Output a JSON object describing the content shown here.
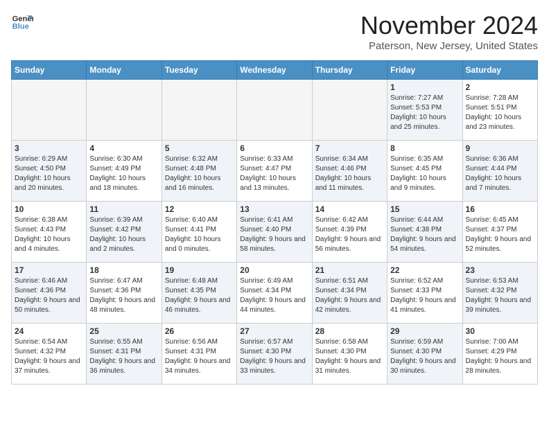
{
  "header": {
    "logo_general": "General",
    "logo_blue": "Blue",
    "month_title": "November 2024",
    "location": "Paterson, New Jersey, United States"
  },
  "days_of_week": [
    "Sunday",
    "Monday",
    "Tuesday",
    "Wednesday",
    "Thursday",
    "Friday",
    "Saturday"
  ],
  "weeks": [
    [
      {
        "day": "",
        "info": "",
        "empty": true
      },
      {
        "day": "",
        "info": "",
        "empty": true
      },
      {
        "day": "",
        "info": "",
        "empty": true
      },
      {
        "day": "",
        "info": "",
        "empty": true
      },
      {
        "day": "",
        "info": "",
        "empty": true
      },
      {
        "day": "1",
        "info": "Sunrise: 7:27 AM\nSunset: 5:53 PM\nDaylight: 10 hours and 25 minutes.",
        "shaded": true
      },
      {
        "day": "2",
        "info": "Sunrise: 7:28 AM\nSunset: 5:51 PM\nDaylight: 10 hours and 23 minutes.",
        "shaded": false
      }
    ],
    [
      {
        "day": "3",
        "info": "Sunrise: 6:29 AM\nSunset: 4:50 PM\nDaylight: 10 hours and 20 minutes.",
        "shaded": true
      },
      {
        "day": "4",
        "info": "Sunrise: 6:30 AM\nSunset: 4:49 PM\nDaylight: 10 hours and 18 minutes.",
        "shaded": false
      },
      {
        "day": "5",
        "info": "Sunrise: 6:32 AM\nSunset: 4:48 PM\nDaylight: 10 hours and 16 minutes.",
        "shaded": true
      },
      {
        "day": "6",
        "info": "Sunrise: 6:33 AM\nSunset: 4:47 PM\nDaylight: 10 hours and 13 minutes.",
        "shaded": false
      },
      {
        "day": "7",
        "info": "Sunrise: 6:34 AM\nSunset: 4:46 PM\nDaylight: 10 hours and 11 minutes.",
        "shaded": true
      },
      {
        "day": "8",
        "info": "Sunrise: 6:35 AM\nSunset: 4:45 PM\nDaylight: 10 hours and 9 minutes.",
        "shaded": false
      },
      {
        "day": "9",
        "info": "Sunrise: 6:36 AM\nSunset: 4:44 PM\nDaylight: 10 hours and 7 minutes.",
        "shaded": true
      }
    ],
    [
      {
        "day": "10",
        "info": "Sunrise: 6:38 AM\nSunset: 4:43 PM\nDaylight: 10 hours and 4 minutes.",
        "shaded": false
      },
      {
        "day": "11",
        "info": "Sunrise: 6:39 AM\nSunset: 4:42 PM\nDaylight: 10 hours and 2 minutes.",
        "shaded": true
      },
      {
        "day": "12",
        "info": "Sunrise: 6:40 AM\nSunset: 4:41 PM\nDaylight: 10 hours and 0 minutes.",
        "shaded": false
      },
      {
        "day": "13",
        "info": "Sunrise: 6:41 AM\nSunset: 4:40 PM\nDaylight: 9 hours and 58 minutes.",
        "shaded": true
      },
      {
        "day": "14",
        "info": "Sunrise: 6:42 AM\nSunset: 4:39 PM\nDaylight: 9 hours and 56 minutes.",
        "shaded": false
      },
      {
        "day": "15",
        "info": "Sunrise: 6:44 AM\nSunset: 4:38 PM\nDaylight: 9 hours and 54 minutes.",
        "shaded": true
      },
      {
        "day": "16",
        "info": "Sunrise: 6:45 AM\nSunset: 4:37 PM\nDaylight: 9 hours and 52 minutes.",
        "shaded": false
      }
    ],
    [
      {
        "day": "17",
        "info": "Sunrise: 6:46 AM\nSunset: 4:36 PM\nDaylight: 9 hours and 50 minutes.",
        "shaded": true
      },
      {
        "day": "18",
        "info": "Sunrise: 6:47 AM\nSunset: 4:36 PM\nDaylight: 9 hours and 48 minutes.",
        "shaded": false
      },
      {
        "day": "19",
        "info": "Sunrise: 6:48 AM\nSunset: 4:35 PM\nDaylight: 9 hours and 46 minutes.",
        "shaded": true
      },
      {
        "day": "20",
        "info": "Sunrise: 6:49 AM\nSunset: 4:34 PM\nDaylight: 9 hours and 44 minutes.",
        "shaded": false
      },
      {
        "day": "21",
        "info": "Sunrise: 6:51 AM\nSunset: 4:34 PM\nDaylight: 9 hours and 42 minutes.",
        "shaded": true
      },
      {
        "day": "22",
        "info": "Sunrise: 6:52 AM\nSunset: 4:33 PM\nDaylight: 9 hours and 41 minutes.",
        "shaded": false
      },
      {
        "day": "23",
        "info": "Sunrise: 6:53 AM\nSunset: 4:32 PM\nDaylight: 9 hours and 39 minutes.",
        "shaded": true
      }
    ],
    [
      {
        "day": "24",
        "info": "Sunrise: 6:54 AM\nSunset: 4:32 PM\nDaylight: 9 hours and 37 minutes.",
        "shaded": false
      },
      {
        "day": "25",
        "info": "Sunrise: 6:55 AM\nSunset: 4:31 PM\nDaylight: 9 hours and 36 minutes.",
        "shaded": true
      },
      {
        "day": "26",
        "info": "Sunrise: 6:56 AM\nSunset: 4:31 PM\nDaylight: 9 hours and 34 minutes.",
        "shaded": false
      },
      {
        "day": "27",
        "info": "Sunrise: 6:57 AM\nSunset: 4:30 PM\nDaylight: 9 hours and 33 minutes.",
        "shaded": true
      },
      {
        "day": "28",
        "info": "Sunrise: 6:58 AM\nSunset: 4:30 PM\nDaylight: 9 hours and 31 minutes.",
        "shaded": false
      },
      {
        "day": "29",
        "info": "Sunrise: 6:59 AM\nSunset: 4:30 PM\nDaylight: 9 hours and 30 minutes.",
        "shaded": true
      },
      {
        "day": "30",
        "info": "Sunrise: 7:00 AM\nSunset: 4:29 PM\nDaylight: 9 hours and 28 minutes.",
        "shaded": false
      }
    ]
  ]
}
